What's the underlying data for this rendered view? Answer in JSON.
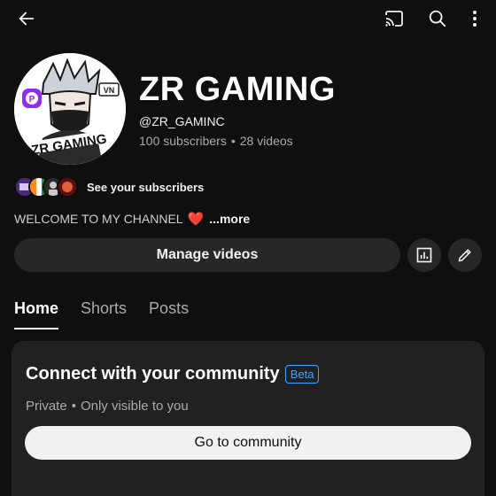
{
  "topbar": {
    "back": "back-arrow-icon",
    "cast": "cast-icon",
    "search": "search-icon",
    "more": "more-vertical-icon"
  },
  "channel": {
    "name": "ZR GAMING",
    "handle": "@ZR_GAMINC",
    "subscribers": "100 subscribers",
    "separator": "•",
    "videos": "28 videos",
    "avatar_logo_text": "ZR GAMING",
    "avatar_badge_text": "VN"
  },
  "subscribers_row": {
    "link_label": "See your subscribers",
    "avatar_count": 4
  },
  "description": {
    "text": "WELCOME TO MY CHANNEL",
    "emoji": "❤️",
    "more_label": "...more"
  },
  "actions": {
    "manage_label": "Manage videos",
    "analytics_icon": "analytics-icon",
    "edit_icon": "edit-pencil-icon"
  },
  "tabs": [
    {
      "label": "Home",
      "active": true
    },
    {
      "label": "Shorts",
      "active": false
    },
    {
      "label": "Posts",
      "active": false
    }
  ],
  "community_card": {
    "title": "Connect with your community",
    "badge": "Beta",
    "privacy": "Private",
    "separator": "•",
    "visibility": "Only visible to you",
    "button_label": "Go to community"
  },
  "colors": {
    "background": "#0f0f0f",
    "surface": "#272727",
    "card": "#212121",
    "accent_blue": "#3ea6ff",
    "text_primary": "#f1f1f1",
    "text_secondary": "#aaaaaa"
  }
}
